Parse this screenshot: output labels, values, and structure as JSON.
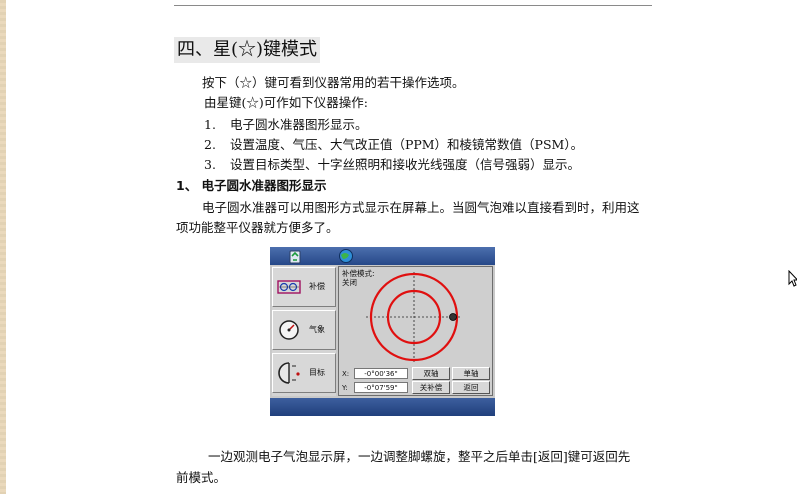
{
  "heading": "四、星(☆)键模式",
  "intro": "按下（☆）键可看到仪器常用的若干操作选项。",
  "star_ops": "由星键(☆)可作如下仪器操作:",
  "list": [
    {
      "num": "1.",
      "text": "电子圆水准器图形显示。"
    },
    {
      "num": "2.",
      "text": "设置温度、气压、大气改正值（PPM）和棱镜常数值（PSM）。"
    },
    {
      "num": "3.",
      "text": "设置目标类型、十字丝照明和接收光线强度（信号强弱）显示。"
    }
  ],
  "sub_heading": "1、 电子圆水准器图形显示",
  "para1_line1": "电子圆水准器可以用图形方式显示在屏幕上。当圆气泡难以直接看到时，利用这",
  "para1_line2": "项功能整平仪器就方便多了。",
  "screen": {
    "side_buttons": [
      {
        "label": "补偿",
        "icon": "compensator-icon"
      },
      {
        "label": "气象",
        "icon": "gauge-icon"
      },
      {
        "label": "目标",
        "icon": "target-prism-icon"
      }
    ],
    "mode_label": "补偿模式:",
    "mode_value": "关闭",
    "x_label": "X:",
    "x_value": "-0°00'36\"",
    "y_label": "Y:",
    "y_value": "-0°07'59\"",
    "buttons": {
      "dual_axis": "双轴",
      "single_axis": "单轴",
      "comp_off": "关补偿",
      "back": "返回"
    },
    "colors": {
      "circle": "#e01010",
      "bar": "#2a4b8d"
    }
  },
  "para2_line1": "一边观测电子气泡显示屏，一边调整脚螺旋，整平之后单击[返回]键可返回先",
  "para2_line2": "前模式。"
}
